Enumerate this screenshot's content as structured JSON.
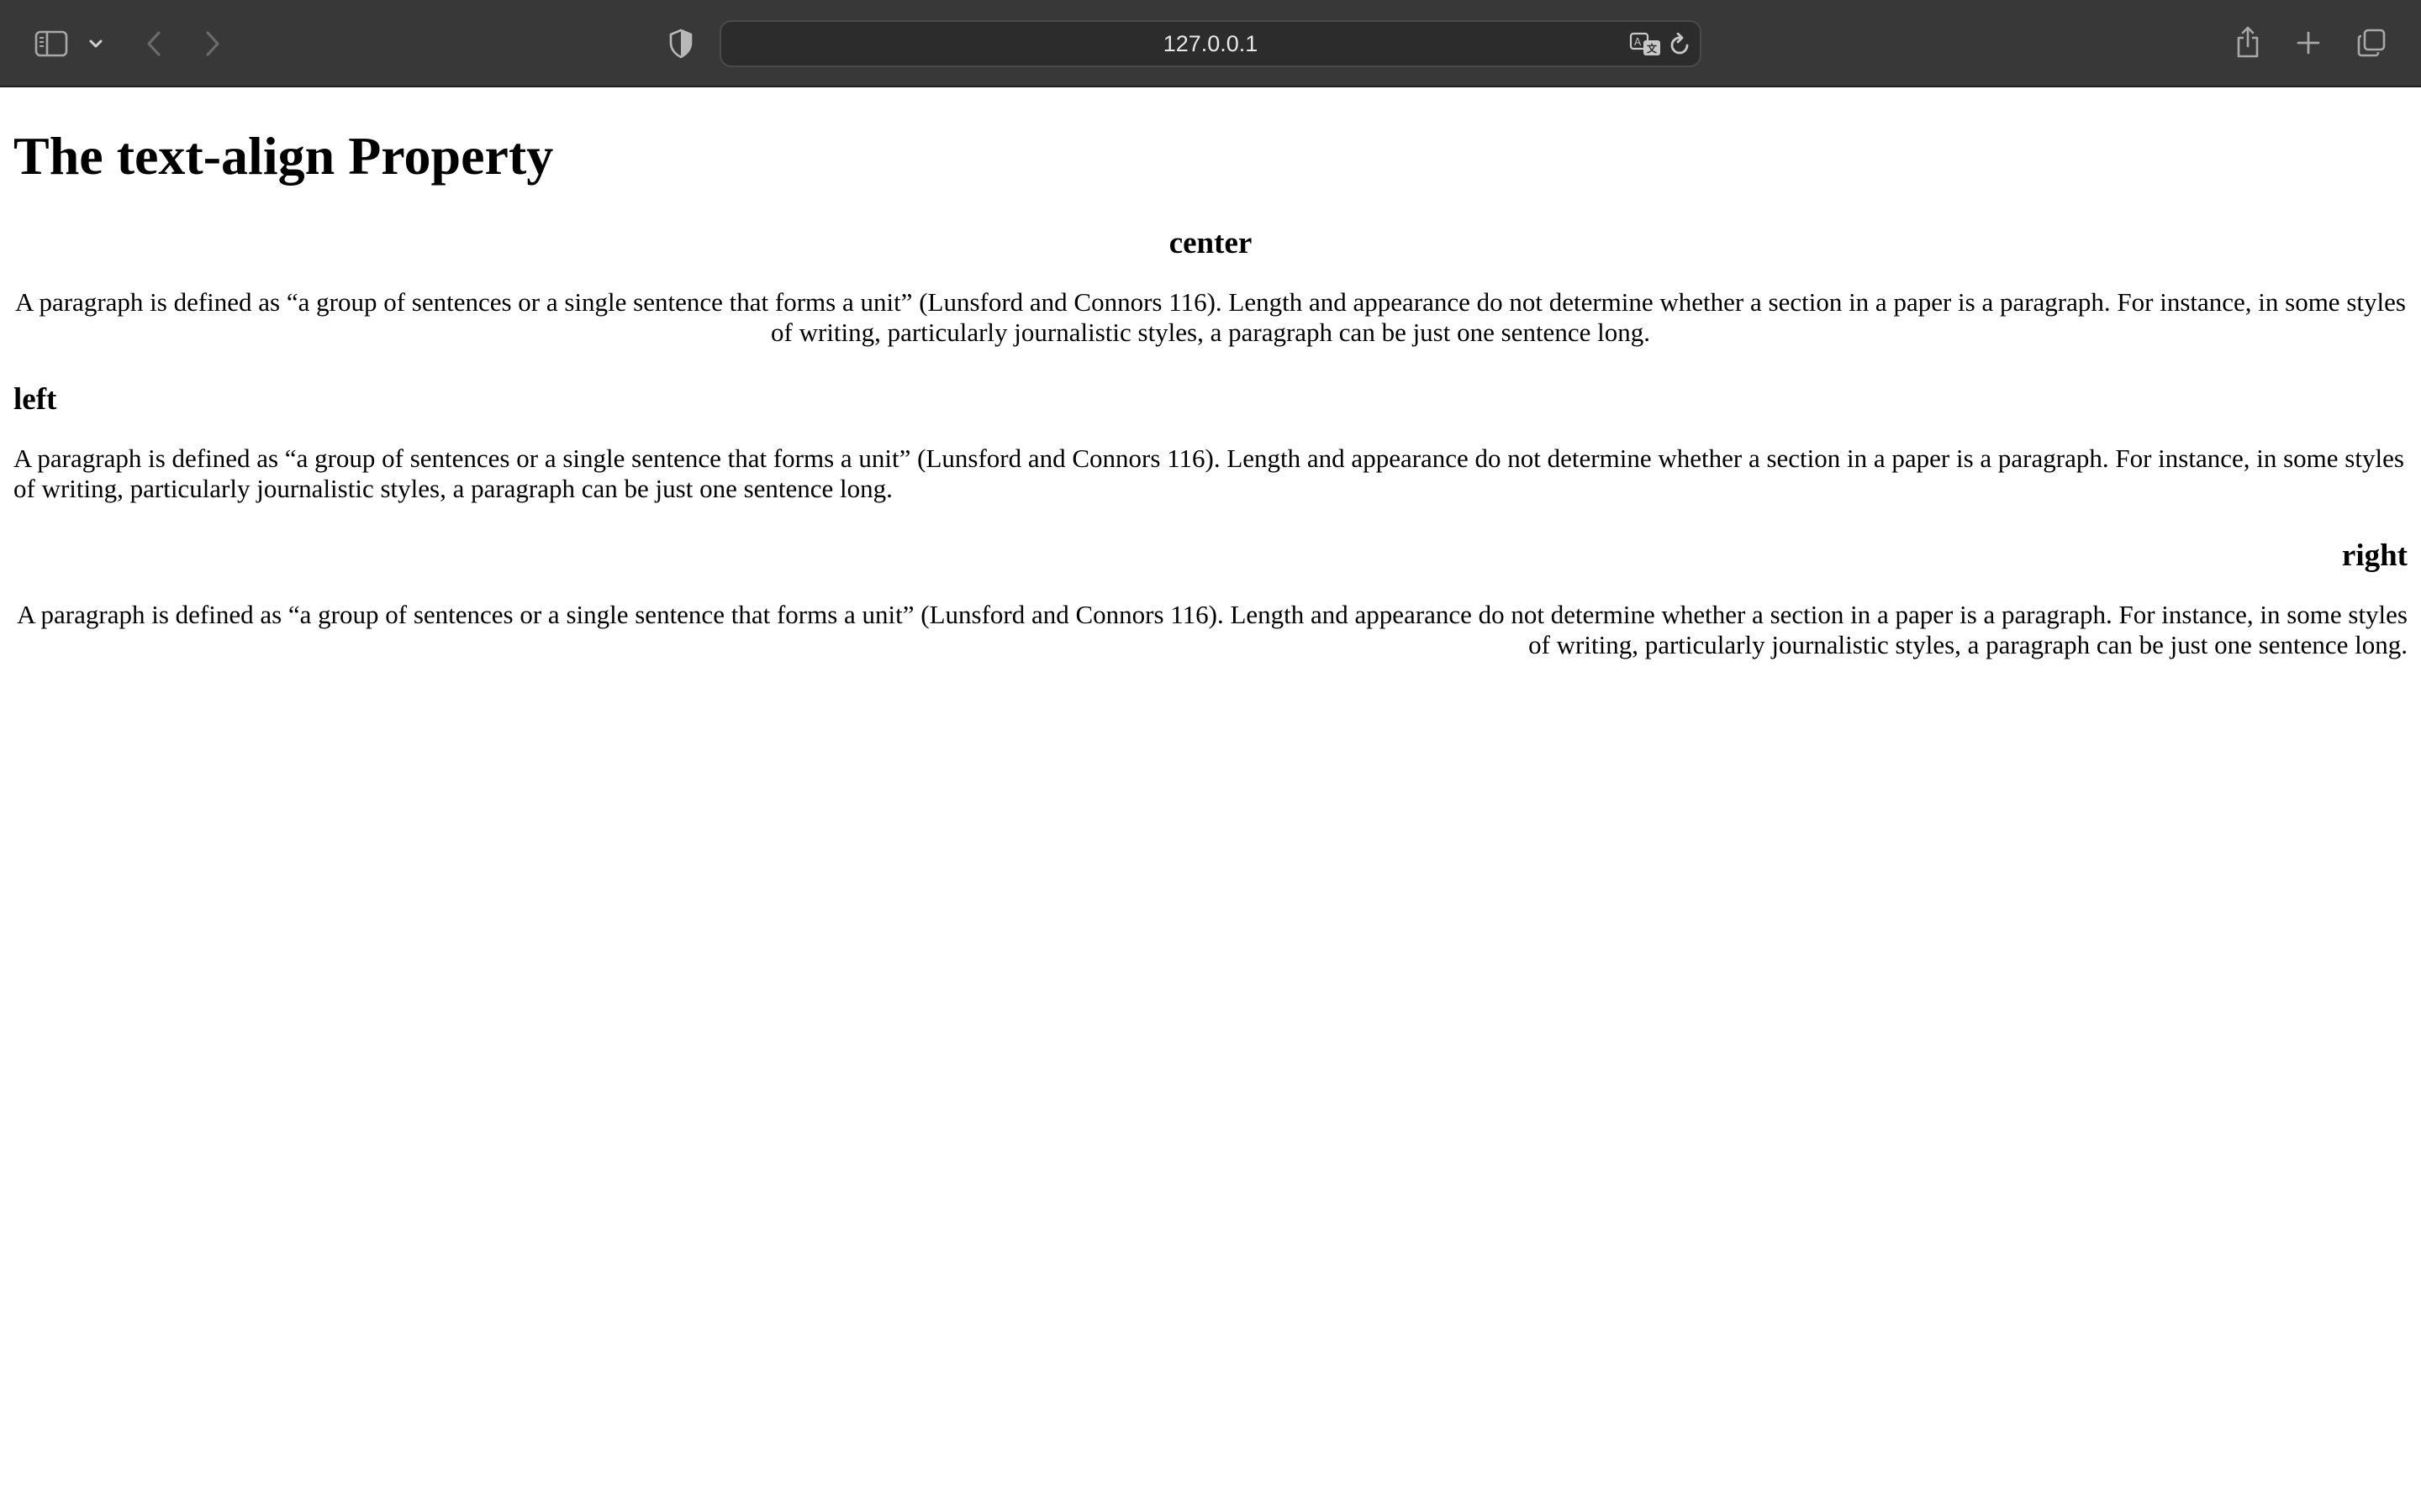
{
  "browser": {
    "url": "127.0.0.1",
    "icons": {
      "sidebar": "sidebar-icon",
      "tab_group_menu": "chevron-down-icon",
      "back": "chevron-left-icon",
      "forward": "chevron-right-icon",
      "privacy": "shield-icon",
      "translate": "translate-icon",
      "reload": "reload-icon",
      "share": "share-icon",
      "new_tab": "plus-icon",
      "tab_overview": "tabs-icon"
    }
  },
  "page": {
    "title": "The text-align Property",
    "sections": [
      {
        "heading": "center",
        "paragraph": "A paragraph is defined as “a group of sentences or a single sentence that forms a unit” (Lunsford and Connors 116). Length and appearance do not determine whether a section in a paper is a paragraph. For instance, in some styles of writing, particularly journalistic styles, a paragraph can be just one sentence long."
      },
      {
        "heading": "left",
        "paragraph": "A paragraph is defined as “a group of sentences or a single sentence that forms a unit” (Lunsford and Connors 116). Length and appearance do not determine whether a section in a paper is a paragraph. For instance, in some styles of writing, particularly journalistic styles, a paragraph can be just one sentence long."
      },
      {
        "heading": "right",
        "paragraph": "A paragraph is defined as “a group of sentences or a single sentence that forms a unit” (Lunsford and Connors 116). Length and appearance do not determine whether a section in a paper is a paragraph. For instance, in some styles of writing, particularly journalistic styles, a paragraph can be just one sentence long."
      }
    ]
  }
}
